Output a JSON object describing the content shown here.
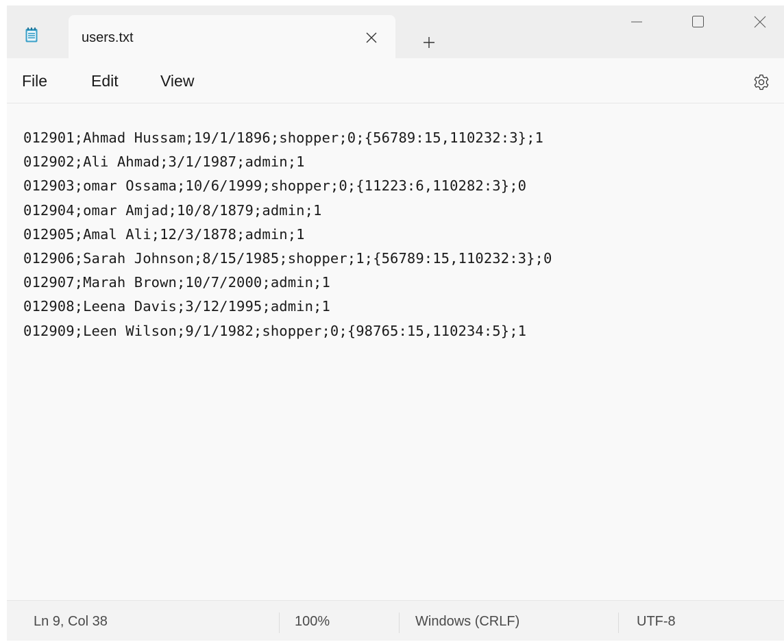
{
  "tab": {
    "title": "users.txt",
    "icon": "notepad-icon"
  },
  "menu": {
    "file": "File",
    "edit": "Edit",
    "view": "View"
  },
  "editor": {
    "lines": [
      "012901;Ahmad Hussam;19/1/1896;shopper;0;{56789:15,110232:3};1",
      "012902;Ali Ahmad;3/1/1987;admin;1",
      "012903;omar Ossama;10/6/1999;shopper;0;{11223:6,110282:3};0",
      "012904;omar Amjad;10/8/1879;admin;1",
      "012905;Amal Ali;12/3/1878;admin;1",
      "012906;Sarah Johnson;8/15/1985;shopper;1;{56789:15,110232:3};0",
      "012907;Marah Brown;10/7/2000;admin;1",
      "012908;Leena Davis;3/12/1995;admin;1",
      "012909;Leen Wilson;9/1/1982;shopper;0;{98765:15,110234:5};1"
    ]
  },
  "status": {
    "position": "Ln 9, Col 38",
    "zoom": "100%",
    "line_ending": "Windows (CRLF)",
    "encoding": "UTF-8"
  },
  "colors": {
    "titlebar_bg": "#eeeeee",
    "window_bg": "#f9f9f9",
    "text": "#1a1a1a",
    "icon_accent": "#3aa0c8"
  }
}
